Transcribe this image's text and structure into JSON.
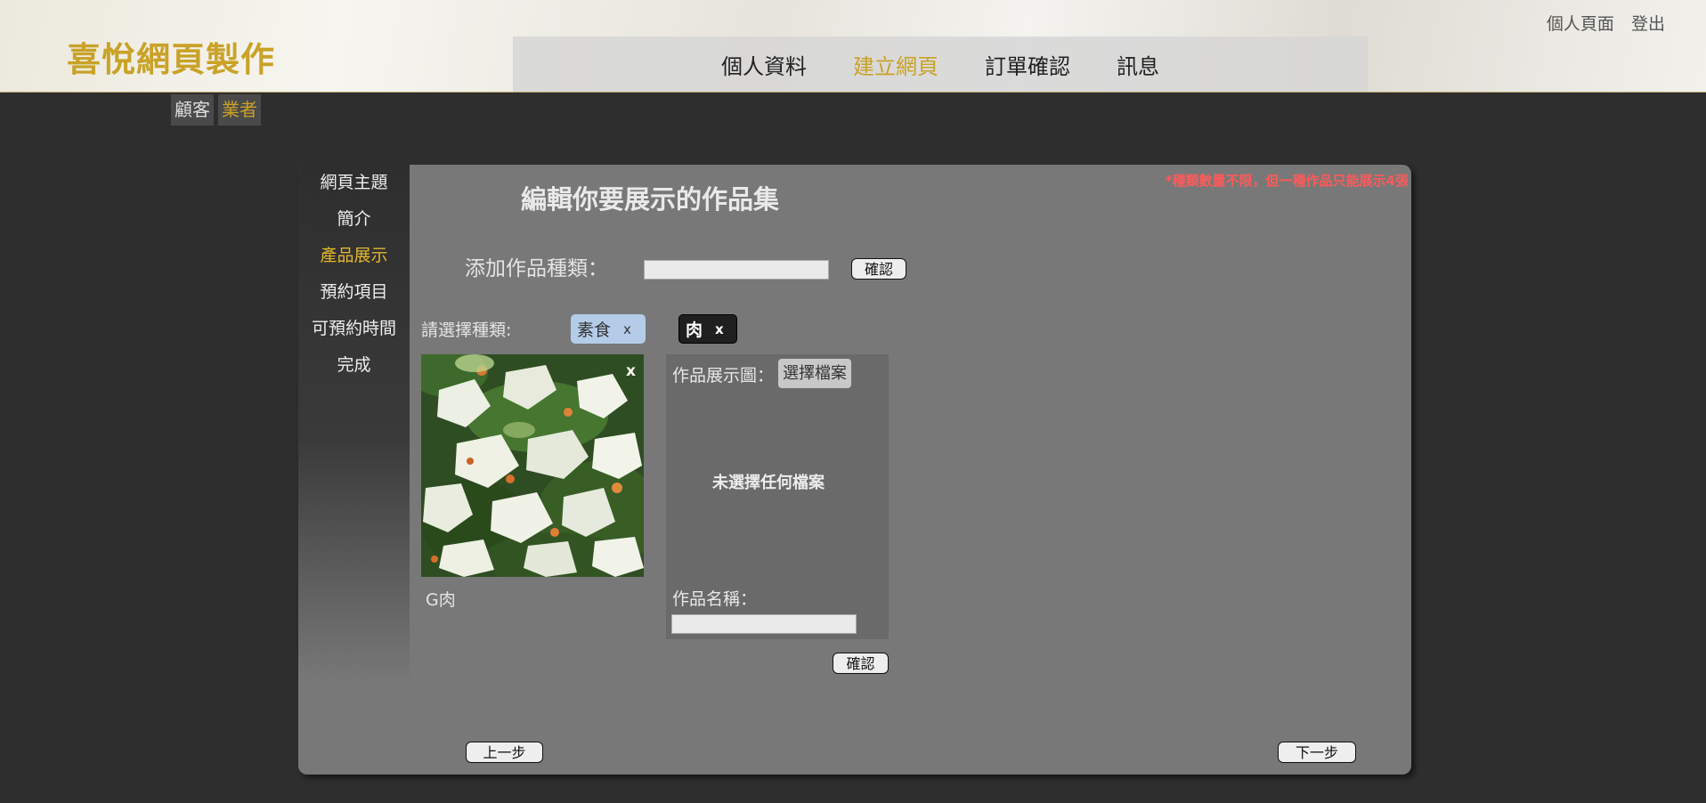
{
  "brand": {
    "title": "喜悅網頁製作",
    "accent_color": "#c9a227"
  },
  "user_links": {
    "profile": "個人頁面",
    "logout": "登出"
  },
  "nav": {
    "items": [
      "個人資料",
      "建立網頁",
      "訂單確認",
      "訊息"
    ],
    "active": "建立網頁"
  },
  "role_tabs": {
    "items": [
      "顧客",
      "業者"
    ],
    "active": "業者"
  },
  "sidebar": {
    "items": [
      "網頁主題",
      "簡介",
      "產品展示",
      "預約項目",
      "可預約時間",
      "完成"
    ],
    "active": "產品展示"
  },
  "panel": {
    "notice": "*種類數量不限，但一種作品只能展示4張",
    "title": "編輯你要展示的作品集",
    "add_category": {
      "label": "添加作品種類：",
      "value": "",
      "confirm_label": "確認"
    },
    "choose_label": "請選擇種類:",
    "categories": [
      {
        "name": "素食",
        "remove": "x",
        "selected": true
      },
      {
        "name": "肉",
        "remove": "x",
        "selected": false
      }
    ],
    "work_card": {
      "name": "G肉",
      "close": "x"
    },
    "upload": {
      "image_label": "作品展示圖：",
      "file_button": "選擇檔案",
      "no_file": "未選擇任何檔案",
      "name_label": "作品名稱：",
      "name_value": "",
      "confirm_label": "確認"
    },
    "prev_label": "上一步",
    "next_label": "下一步"
  }
}
